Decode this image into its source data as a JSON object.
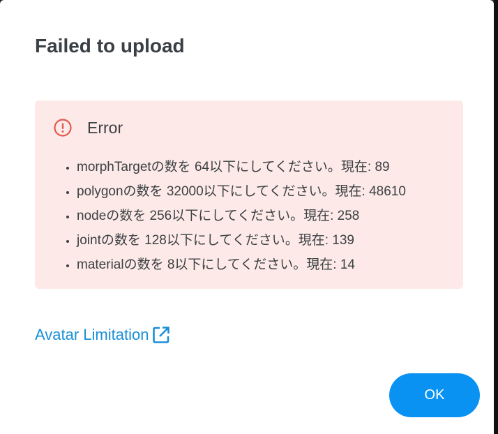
{
  "dialog": {
    "title": "Failed to upload",
    "error": {
      "icon": "error-circle-icon",
      "color": "#e05a4f",
      "background": "#fdeae8",
      "title": "Error",
      "items": [
        "morphTargetの数を 64以下にしてください。現在: 89",
        "polygonの数を 32000以下にしてください。現在: 48610",
        "nodeの数を 256以下にしてください。現在: 258",
        "jointの数を 128以下にしてください。現在: 139",
        "materialの数を 8以下にしてください。現在: 14"
      ]
    },
    "link": {
      "label": "Avatar Limitation",
      "icon": "external-link-icon",
      "color": "#1a8fd6"
    },
    "ok_button": {
      "label": "OK",
      "color": "#0a92f2"
    }
  }
}
